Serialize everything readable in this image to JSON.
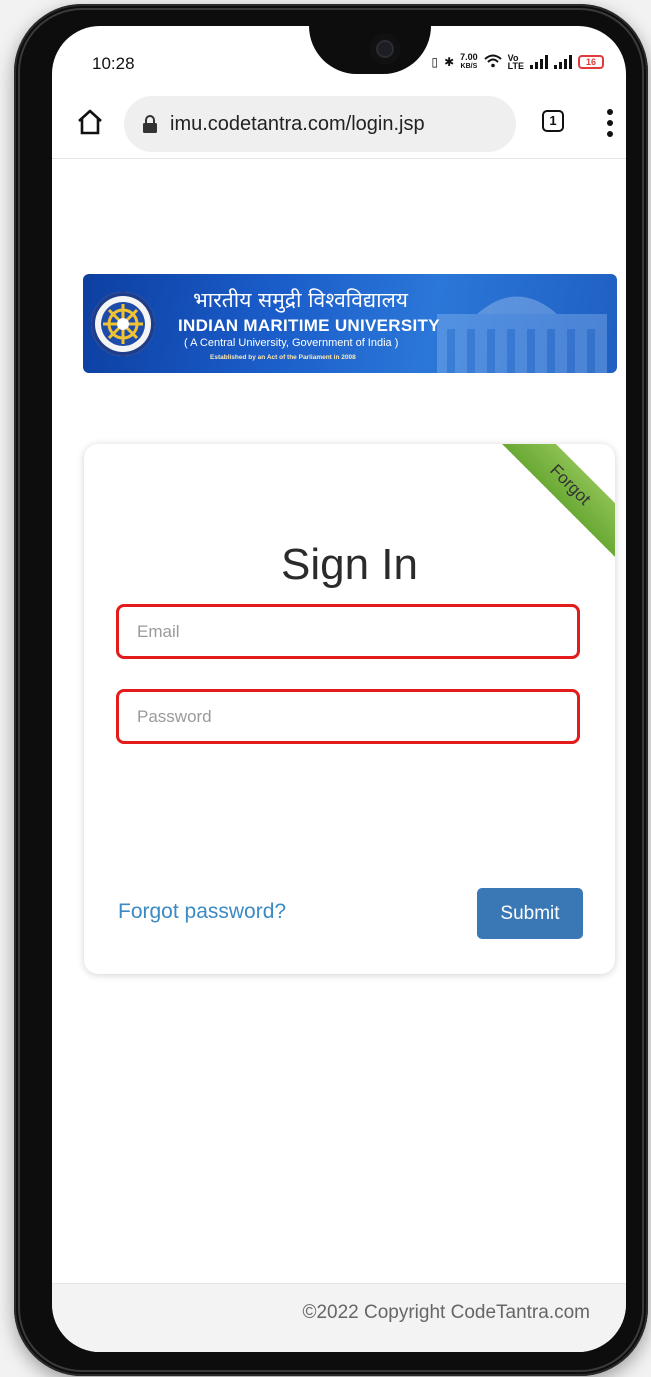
{
  "status_bar": {
    "time": "10:28",
    "net_speed": "7.00",
    "net_unit": "KB/S",
    "battery": "16"
  },
  "browser": {
    "url": "imu.codetantra.com/login.jsp",
    "tab_count": "1"
  },
  "banner": {
    "hindi_title": "भारतीय समुद्री विश्वविद्यालय",
    "english_title": "INDIAN MARITIME UNIVERSITY",
    "subtitle": "( A Central University, Government of India )",
    "established": "Established by an Act of the Parliament in 2008"
  },
  "login": {
    "ribbon": "Forgot",
    "title": "Sign In",
    "email_placeholder": "Email",
    "password_placeholder": "Password",
    "forgot_link": "Forgot password?",
    "submit_label": "Submit"
  },
  "footer": {
    "copyright": "©2022 Copyright CodeTantra.com"
  },
  "colors": {
    "field_border": "#e41b1b",
    "submit_bg": "#3a78b5",
    "link": "#3b8ac4",
    "ribbon": "#7cb342"
  }
}
